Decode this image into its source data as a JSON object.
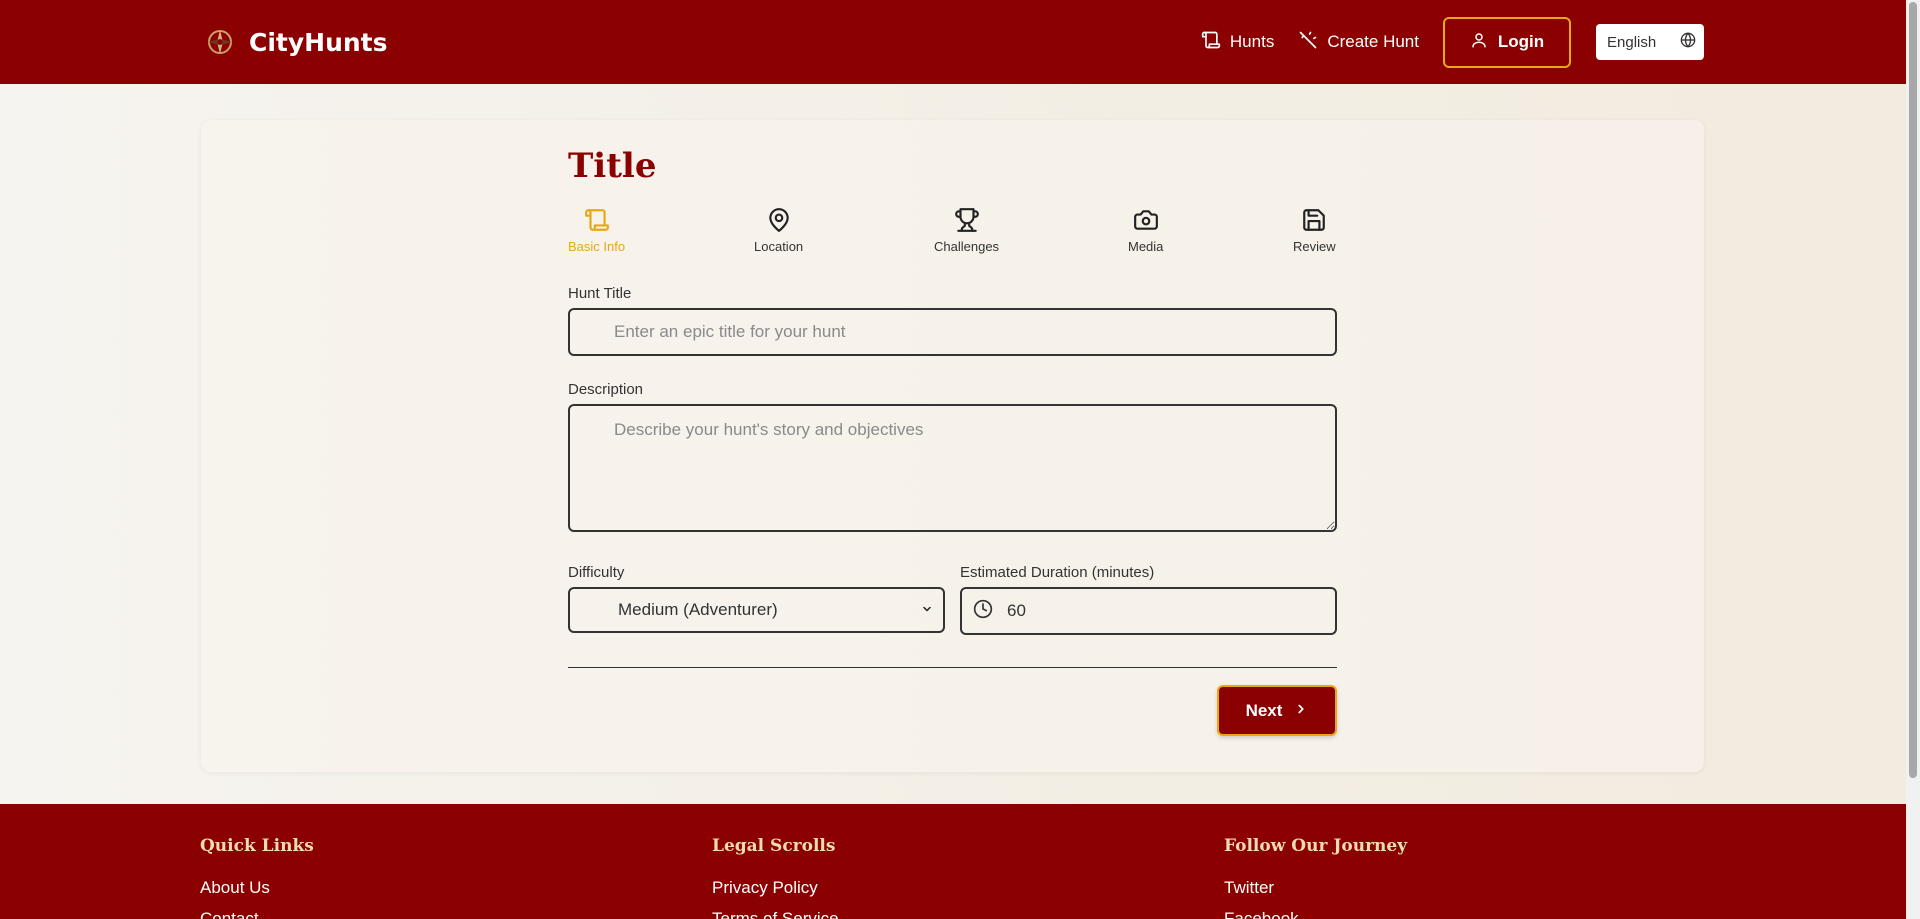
{
  "header": {
    "brand": "CityHunts",
    "nav": {
      "hunts": "Hunts",
      "create_hunt": "Create Hunt",
      "login": "Login",
      "language": "English"
    }
  },
  "form": {
    "title": "Title",
    "steps": [
      {
        "label": "Basic Info",
        "icon": "scroll-icon",
        "active": true
      },
      {
        "label": "Location",
        "icon": "map-pin-icon",
        "active": false
      },
      {
        "label": "Challenges",
        "icon": "trophy-icon",
        "active": false
      },
      {
        "label": "Media",
        "icon": "camera-icon",
        "active": false
      },
      {
        "label": "Review",
        "icon": "save-icon",
        "active": false
      }
    ],
    "hunt_title_label": "Hunt Title",
    "hunt_title_placeholder": "Enter an epic title for your hunt",
    "description_label": "Description",
    "description_placeholder": "Describe your hunt's story and objectives",
    "difficulty_label": "Difficulty",
    "difficulty_value": "Medium (Adventurer)",
    "duration_label": "Estimated Duration (minutes)",
    "duration_value": "60",
    "next_label": "Next"
  },
  "footer": {
    "columns": [
      {
        "heading": "Quick Links",
        "links": [
          "About Us",
          "Contact"
        ]
      },
      {
        "heading": "Legal Scrolls",
        "links": [
          "Privacy Policy",
          "Terms of Service"
        ]
      },
      {
        "heading": "Follow Our Journey",
        "links": [
          "Twitter",
          "Facebook"
        ]
      }
    ]
  },
  "colors": {
    "primary": "#8b0000",
    "accent": "#e6a817"
  }
}
